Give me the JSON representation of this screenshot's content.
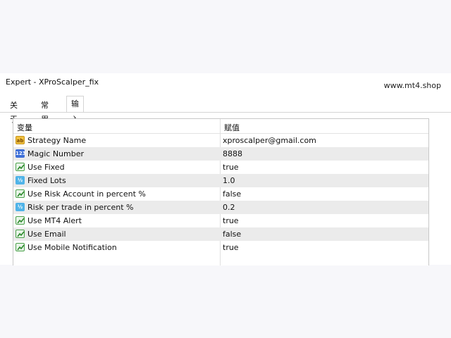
{
  "window": {
    "title": "Expert - XProScalper_fix",
    "watermark": "www.mt4.shop"
  },
  "tabs": [
    {
      "label": "关于",
      "active": false
    },
    {
      "label": "常用",
      "active": false
    },
    {
      "label": "输入参数",
      "active": true
    }
  ],
  "table": {
    "headers": {
      "variable": "变量",
      "value": "赋值"
    },
    "rows": [
      {
        "icon": "string-type-icon",
        "glyph": "ab",
        "name": "Strategy Name",
        "value": "xproscalper@gmail.com"
      },
      {
        "icon": "integer-type-icon",
        "glyph": "123",
        "name": "Magic Number",
        "value": "8888"
      },
      {
        "icon": "boolean-type-icon",
        "glyph": "",
        "name": "Use Fixed",
        "value": "true"
      },
      {
        "icon": "double-type-icon",
        "glyph": "½",
        "name": "Fixed Lots",
        "value": "1.0"
      },
      {
        "icon": "boolean-type-icon",
        "glyph": "",
        "name": "Use Risk Account in percent %",
        "value": "false"
      },
      {
        "icon": "double-type-icon",
        "glyph": "½",
        "name": "Risk per trade in percent %",
        "value": "0.2"
      },
      {
        "icon": "boolean-type-icon",
        "glyph": "",
        "name": "Use MT4 Alert",
        "value": "true"
      },
      {
        "icon": "boolean-type-icon",
        "glyph": "",
        "name": "Use Email",
        "value": "false"
      },
      {
        "icon": "boolean-type-icon",
        "glyph": "",
        "name": "Use Mobile Notification",
        "value": "true"
      }
    ]
  }
}
